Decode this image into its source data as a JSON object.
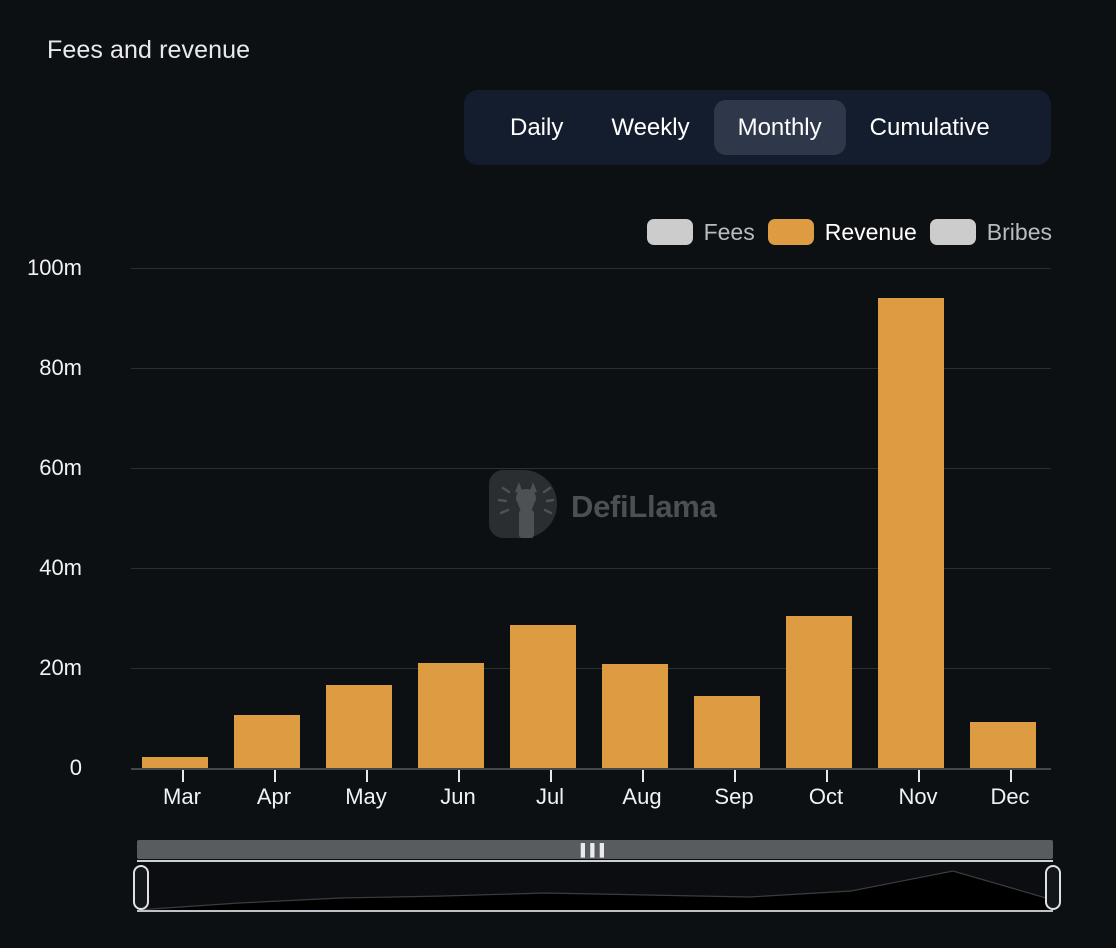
{
  "header": {
    "title": "Fees and revenue"
  },
  "interval_tabs": {
    "active": "Monthly",
    "items": [
      {
        "label": "Daily"
      },
      {
        "label": "Weekly"
      },
      {
        "label": "Monthly"
      },
      {
        "label": "Cumulative"
      }
    ]
  },
  "legend": {
    "items": [
      {
        "label": "Fees",
        "color": "#cccccc",
        "active": false
      },
      {
        "label": "Revenue",
        "color": "#dd9c42",
        "active": true
      },
      {
        "label": "Bribes",
        "color": "#cccccc",
        "active": false
      }
    ]
  },
  "watermark": {
    "text": "DefiLlama",
    "logo_icon": "defillama-logo-icon"
  },
  "brush": {
    "grip_icon": "drag-grip-icon",
    "left_handle_icon": "brush-handle-left-icon",
    "right_handle_icon": "brush-handle-right-icon"
  },
  "chart_data": {
    "type": "bar",
    "title": "Fees and revenue",
    "xlabel": "",
    "ylabel": "",
    "categories": [
      "Mar",
      "Apr",
      "May",
      "Jun",
      "Jul",
      "Aug",
      "Sep",
      "Oct",
      "Nov",
      "Dec"
    ],
    "ytick_labels": [
      "0",
      "20m",
      "40m",
      "60m",
      "80m",
      "100m"
    ],
    "ytick_values": [
      0,
      20000000,
      40000000,
      60000000,
      80000000,
      100000000
    ],
    "ylim": [
      0,
      100000000
    ],
    "grid": true,
    "legend_position": "top-right",
    "series": [
      {
        "name": "Fees",
        "color": "#cccccc",
        "visible": false,
        "values": [
          null,
          null,
          null,
          null,
          null,
          null,
          null,
          null,
          null,
          null
        ]
      },
      {
        "name": "Revenue",
        "color": "#dd9c42",
        "visible": true,
        "values": [
          2200000,
          10600000,
          16600000,
          21000000,
          28700000,
          20800000,
          14500000,
          30500000,
          94000000,
          9300000
        ]
      },
      {
        "name": "Bribes",
        "color": "#cccccc",
        "visible": false,
        "values": [
          null,
          null,
          null,
          null,
          null,
          null,
          null,
          null,
          null,
          null
        ]
      }
    ]
  }
}
